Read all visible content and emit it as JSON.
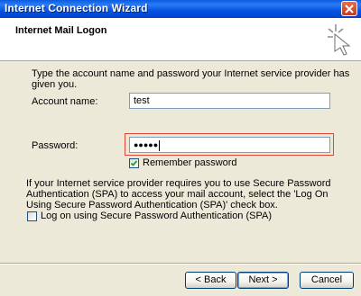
{
  "window": {
    "title": "Internet Connection Wizard"
  },
  "header": {
    "title": "Internet Mail Logon",
    "icon": "wizard-sparkle-icon"
  },
  "instruction": "Type the account name and password your Internet service provider has given you.",
  "account": {
    "label": "Account name:",
    "value": "test"
  },
  "password": {
    "label": "Password:",
    "masked_value": "●●●●●"
  },
  "remember": {
    "label": "Remember password",
    "checked": true
  },
  "spa": {
    "info": "If your Internet service provider requires you to use Secure Password Authentication (SPA) to access your mail account, select the 'Log On Using Secure Password Authentication (SPA)' check box.",
    "checkbox_label": "Log on using Secure Password Authentication (SPA)",
    "checked": false
  },
  "buttons": {
    "back": "< Back",
    "next": "Next >",
    "cancel": "Cancel"
  },
  "colors": {
    "titlebar": "#0A5BE0",
    "highlight": "#E0463A",
    "dialog": "#ECE9D8"
  }
}
